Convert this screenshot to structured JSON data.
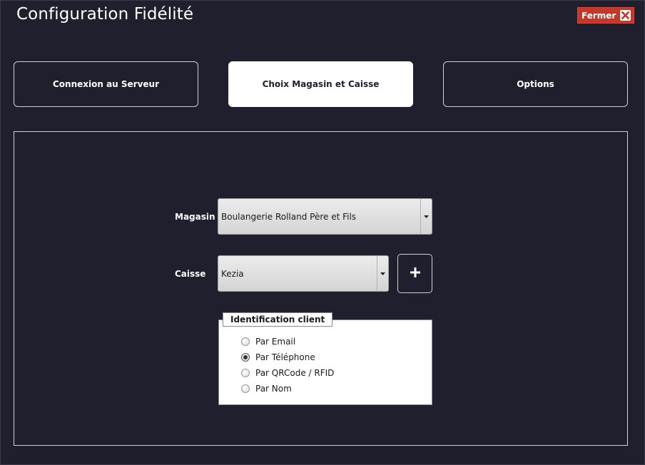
{
  "window": {
    "title": "Configuration Fidélité",
    "close_label": "Fermer"
  },
  "tabs": [
    {
      "label": "Connexion au Serveur",
      "active": false
    },
    {
      "label": "Choix Magasin et Caisse",
      "active": true
    },
    {
      "label": "Options",
      "active": false
    }
  ],
  "form": {
    "magasin_label": "Magasin",
    "magasin_value": "Boulangerie Rolland Père et Fils",
    "caisse_label": "Caisse",
    "caisse_value": "Kezia",
    "add_icon": "plus-icon"
  },
  "identification": {
    "legend": "Identification client",
    "options": [
      {
        "label": "Par Email",
        "checked": false
      },
      {
        "label": "Par Téléphone",
        "checked": true
      },
      {
        "label": "Par QRCode / RFID",
        "checked": false
      },
      {
        "label": "Par Nom",
        "checked": false
      }
    ]
  },
  "colors": {
    "background": "#1f1f2d",
    "close_button": "#c0392b",
    "active_tab": "#ffffff"
  }
}
